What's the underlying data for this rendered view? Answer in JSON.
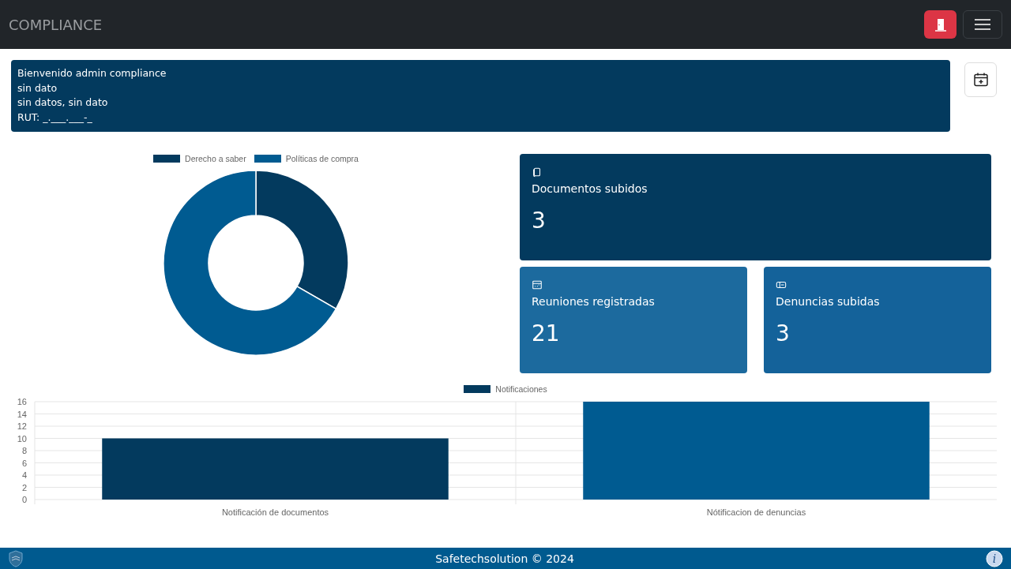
{
  "navbar": {
    "brand": "COMPLIANCE"
  },
  "welcome": {
    "lines": [
      "Bienvenido admin compliance",
      "sin dato",
      "sin datos, sin dato",
      "RUT: _.___.___-_"
    ]
  },
  "donut": {
    "chart_data": {
      "type": "donut",
      "categories": [
        "Derecho a saber",
        "Políticas de compra"
      ],
      "series": [
        {
          "values": [
            33.3,
            66.7
          ]
        }
      ],
      "colors": [
        "#033a5e",
        "#005b91"
      ]
    }
  },
  "stats": [
    {
      "kind": "documents",
      "label": "Documentos subidos",
      "value": "3",
      "color": "#033a5e"
    },
    {
      "kind": "meetings",
      "label": "Reuniones registradas",
      "value": "21",
      "color": "#1c6a9e"
    },
    {
      "kind": "complaints",
      "label": "Denuncias subidas",
      "value": "3",
      "color": "#14629a"
    }
  ],
  "bars": {
    "chart_data": {
      "type": "bar",
      "categories": [
        "Notificación de documentos",
        "Nótificacion de denuncias"
      ],
      "series": [
        {
          "name": "Notificaciones",
          "values": [
            10,
            16
          ]
        }
      ],
      "colors": [
        "#033a5e",
        "#005b91"
      ],
      "grid": true,
      "ylim": [
        0,
        16
      ],
      "yticks": [
        0,
        2,
        4,
        6,
        8,
        10,
        12,
        14,
        16
      ]
    }
  },
  "footer": {
    "text": "Safetechsolution © 2024",
    "info_label": "i"
  }
}
